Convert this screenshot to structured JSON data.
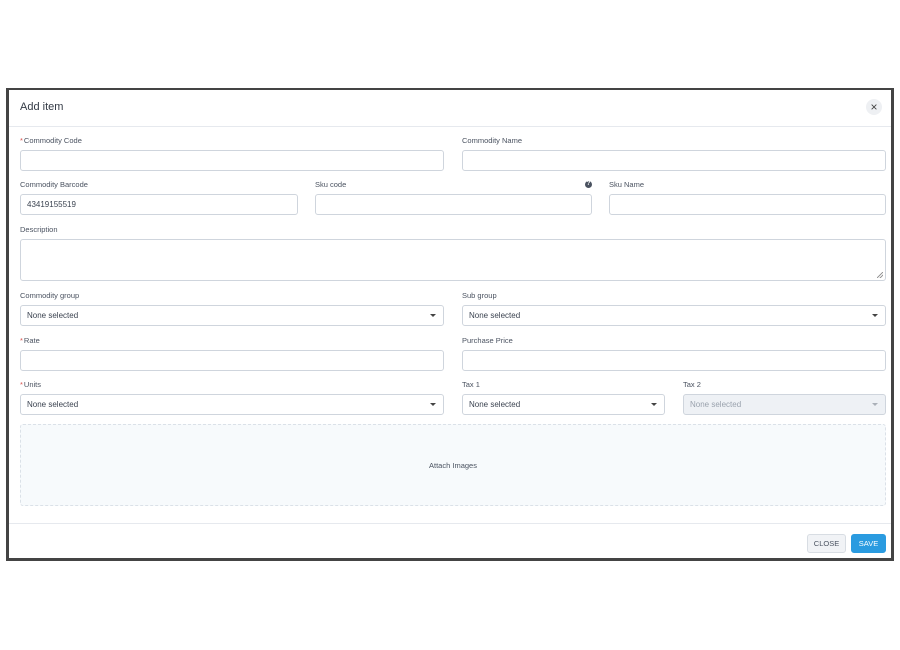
{
  "dialog": {
    "title": "Add item",
    "close_icon": "×"
  },
  "fields": {
    "commodity_code": {
      "label": "Commodity Code",
      "required": "*",
      "value": ""
    },
    "commodity_name": {
      "label": "Commodity Name",
      "value": ""
    },
    "commodity_barcode": {
      "label": "Commodity Barcode",
      "value": "43419155519"
    },
    "sku_code": {
      "label": "Sku code",
      "value": "",
      "help_icon": "?"
    },
    "sku_name": {
      "label": "Sku Name",
      "value": ""
    },
    "description": {
      "label": "Description",
      "value": ""
    },
    "commodity_group": {
      "label": "Commodity group",
      "value": "None selected"
    },
    "sub_group": {
      "label": "Sub group",
      "value": "None selected"
    },
    "rate": {
      "label": "Rate",
      "required": "*",
      "value": ""
    },
    "purchase_price": {
      "label": "Purchase Price",
      "value": ""
    },
    "units": {
      "label": "Units",
      "required": "*",
      "value": "None selected"
    },
    "tax1": {
      "label": "Tax 1",
      "value": "None selected"
    },
    "tax2": {
      "label": "Tax 2",
      "value": "None selected"
    }
  },
  "attach": {
    "label": "Attach Images"
  },
  "footer": {
    "close_label": "CLOSE",
    "save_label": "SAVE"
  },
  "colors": {
    "save_button": "#2a9be0",
    "required_star": "#d9534f",
    "border": "#cfd5dd"
  }
}
